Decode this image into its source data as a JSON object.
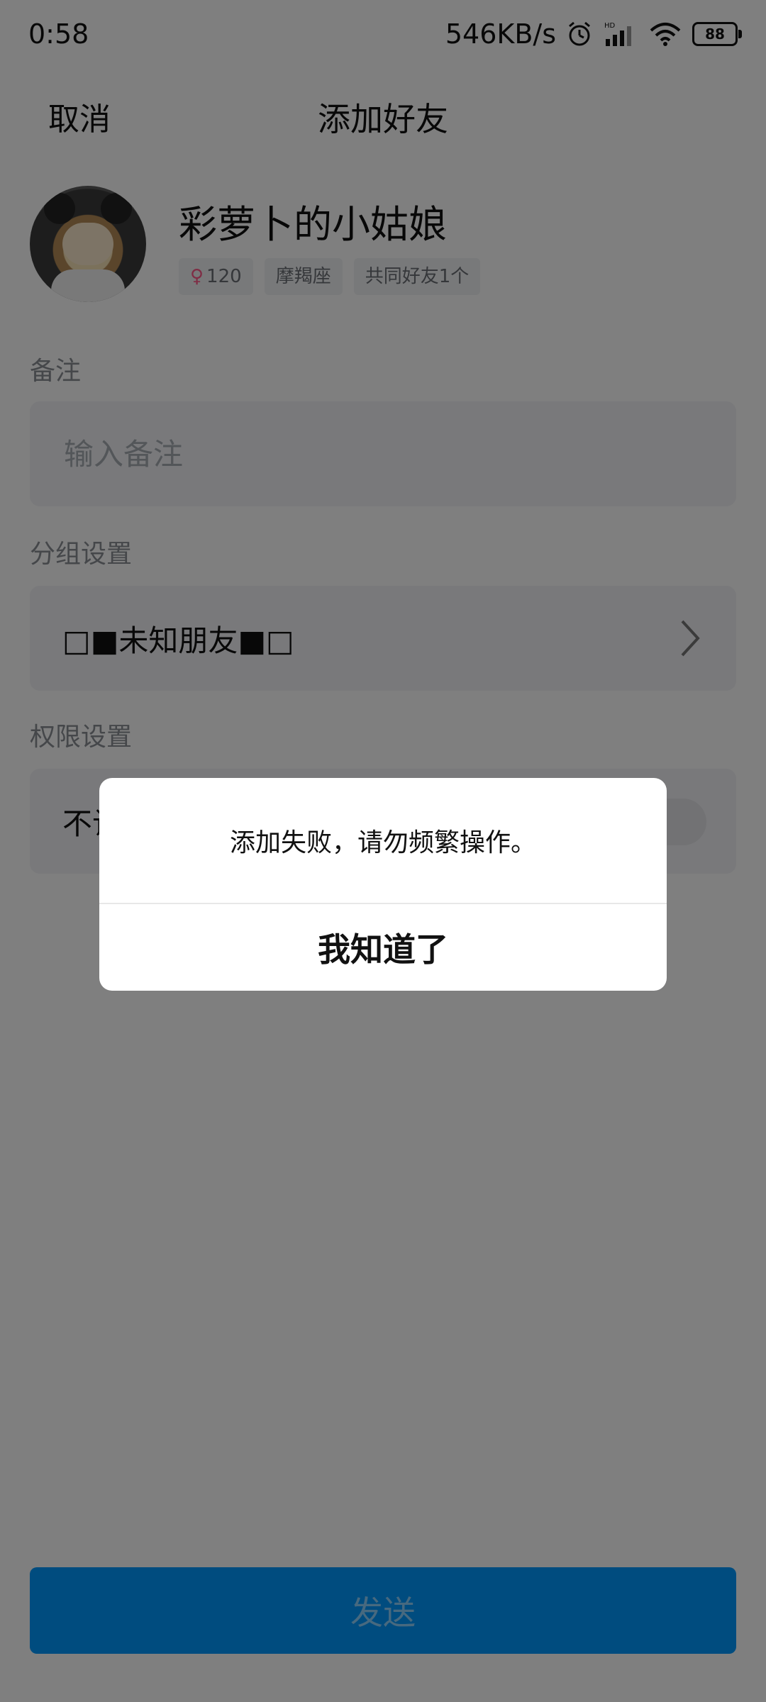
{
  "status_bar": {
    "time": "0:58",
    "speed": "546KB/s",
    "hd_label": "HD",
    "battery": "88"
  },
  "nav": {
    "cancel_label": "取消",
    "title": "添加好友"
  },
  "profile": {
    "nickname": "彩萝卜的小姑娘",
    "tags": {
      "age": "120",
      "zodiac": "摩羯座",
      "mutual": "共同好友1个"
    }
  },
  "remark": {
    "label": "备注",
    "placeholder": "输入备注"
  },
  "group": {
    "label": "分组设置",
    "value": "□■未知朋友■□"
  },
  "permission": {
    "label": "权限设置",
    "value": "不让"
  },
  "send_label": "发送",
  "dialog": {
    "message": "添加失败，请勿频繁操作。",
    "button_label": "我知道了"
  },
  "colors": {
    "accent": "#0099ff",
    "overlay": "rgba(0,0,0,0.5)"
  }
}
